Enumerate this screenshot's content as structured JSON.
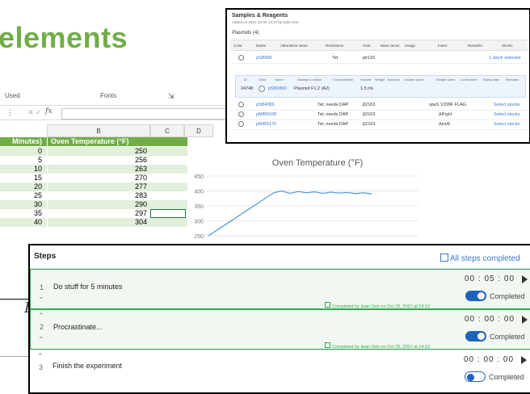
{
  "title": "elements",
  "spreadsheet": {
    "ribbon": {
      "left_label": "Used",
      "center_label": "Fonts"
    },
    "formula_bar": {
      "cancel": "✕",
      "confirm": "✓",
      "fx": "fx"
    },
    "columns": [
      "B",
      "C",
      "D"
    ],
    "header": {
      "a": "Minutes)",
      "b": "Oven Temperature (°F)"
    },
    "rows": [
      {
        "a": "0",
        "b": "250"
      },
      {
        "a": "5",
        "b": "256"
      },
      {
        "a": "10",
        "b": "263"
      },
      {
        "a": "15",
        "b": "270"
      },
      {
        "a": "20",
        "b": "277"
      },
      {
        "a": "25",
        "b": "283"
      },
      {
        "a": "30",
        "b": "290"
      },
      {
        "a": "35",
        "b": "297"
      },
      {
        "a": "40",
        "b": "304"
      }
    ]
  },
  "chart_data": {
    "type": "line",
    "title": "Oven Temperature (°F)",
    "y_ticks": [
      "450",
      "400",
      "350",
      "300",
      "250"
    ],
    "ylim": [
      250,
      450
    ],
    "series": [
      {
        "values": [
          250,
          268,
          286,
          304,
          322,
          340,
          358,
          376,
          394,
          400,
          392,
          398,
          394,
          397,
          392,
          396,
          393,
          395,
          391,
          394,
          390
        ]
      }
    ]
  },
  "samples": {
    "title": "Samples & Reagents",
    "subtitle": "Added on 2021-10-25 14:14 by Iwan Grin",
    "plasmids_label": "Plasmids (4)",
    "headers": [
      "Color",
      "Name",
      "Alternative name",
      "Resistance",
      "Host",
      "Base vector",
      "Usage",
      "Insert",
      "Remarks",
      "Stocks"
    ],
    "rows": [
      {
        "name": "pSB890",
        "resistance": "Tet",
        "host": "pir116",
        "insert": "",
        "stocks": "1 stock selected"
      },
      {
        "name": "pSB4086",
        "resistance": "Tet, needs DAP",
        "host": "β2163",
        "insert": "spaS V299F FLAG",
        "stocks": "Select stocks"
      },
      {
        "name": "pMIB5168",
        "resistance": "Tet, needs DAP",
        "host": "β2163",
        "insert": "ΔPrgH",
        "stocks": "Select stocks"
      },
      {
        "name": "pMIB5175",
        "resistance": "Tet, needs DAP",
        "host": "β2163",
        "insert": "ΔinvE",
        "stocks": "Select stocks"
      }
    ],
    "sub_headers": [
      "ID",
      "Color",
      "Name",
      "Storage Location",
      "Concentration",
      "Volume",
      "Weight",
      "Barcode",
      "Volume Used",
      "Weight Used",
      "Lot Number",
      "Expiry date",
      "Remarks"
    ],
    "sub_row": {
      "id": "24748",
      "name": "pSB0890",
      "location": "Plasmid F1.2 (A2)",
      "volume": "1.5 mL"
    }
  },
  "steps": {
    "title": "Steps",
    "all_completed_label": "All steps completed",
    "items": [
      {
        "num": "1",
        "text": "Do stuff for 5 minutes",
        "timer": "00 : 05 : 00",
        "toggle_label": "Completed",
        "completed_by": "Completed by Iwan Grin on Oct 25, 2021 at 14:12",
        "done": true
      },
      {
        "num": "2",
        "text": "Procrastinate...",
        "timer": "00 : 00 : 00",
        "toggle_label": "Completed",
        "completed_by": "Completed by Iwan Grin on Oct 25, 2021 at 14:12",
        "done": true
      },
      {
        "num": "3",
        "text": "Finish the experiment",
        "timer": "00 : 00 : 00",
        "toggle_label": "Completed",
        "completed_by": "",
        "done": false
      }
    ]
  },
  "colors": {
    "accent_green": "#70ad47",
    "link_blue": "#3a78d4",
    "toggle_blue": "#1f63b8",
    "completed_green": "#2fa84f"
  }
}
